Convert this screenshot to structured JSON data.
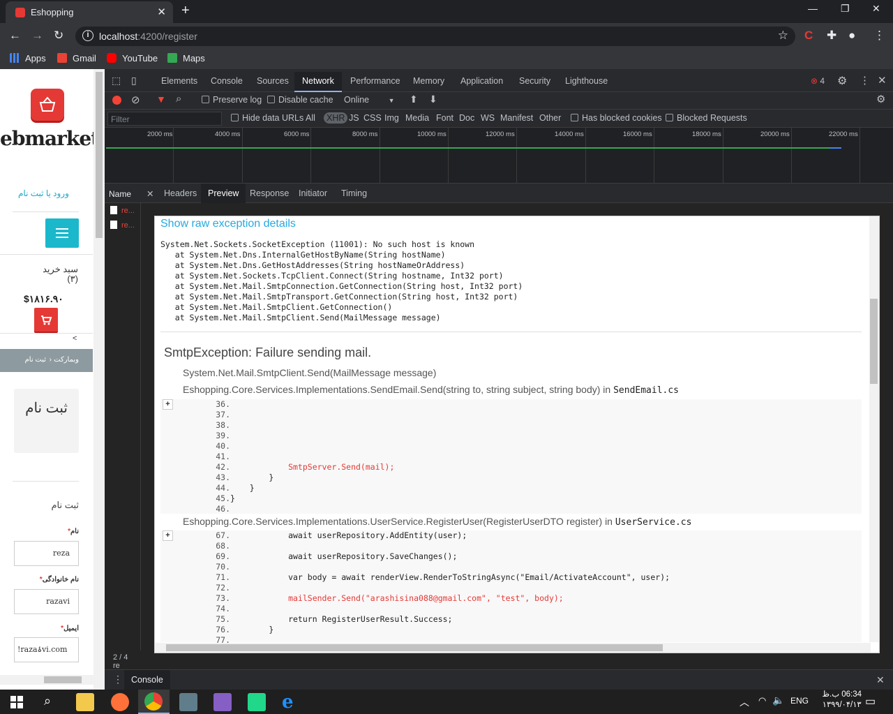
{
  "browser": {
    "tab_title": "Eshopping",
    "url_host": "localhost",
    "url_rest": ":4200/register",
    "bookmarks": [
      "Apps",
      "Gmail",
      "YouTube",
      "Maps"
    ]
  },
  "page": {
    "logo_text": "ebmarket",
    "login_link": "ورود یا ثبت نام",
    "cart_title": "سبد خرید",
    "cart_count": "(۳)",
    "cart_price": "$۱۸۱۶.۹۰",
    "breadcrumb_home": "وبمارکت",
    "breadcrumb_sep": "‹",
    "breadcrumb_current": "ثبت نام",
    "collapse_arrow": "<",
    "register_box_title": "ثبت نام",
    "form_heading": "ثبت نام",
    "fields": [
      {
        "label": "نام",
        "value": "reza"
      },
      {
        "label": "نام خانوادگی",
        "value": "razavi"
      },
      {
        "label": "ایمیل",
        "value": "!razaۀvi.com"
      }
    ],
    "required_mark": "*"
  },
  "devtools": {
    "tabs": [
      "Elements",
      "Console",
      "Sources",
      "Network",
      "Performance",
      "Memory",
      "Application",
      "Security",
      "Lighthouse"
    ],
    "active_tab": "Network",
    "error_count": "4",
    "toolbar": {
      "preserve_log": "Preserve log",
      "disable_cache": "Disable cache",
      "throttle": "Online"
    },
    "filter": {
      "placeholder": "Filter",
      "hide_data_urls": "Hide data URLs",
      "types": [
        "All",
        "XHR",
        "JS",
        "CSS",
        "Img",
        "Media",
        "Font",
        "Doc",
        "WS",
        "Manifest",
        "Other"
      ],
      "selected_type": "XHR",
      "has_blocked_cookies": "Has blocked cookies",
      "blocked_requests": "Blocked Requests"
    },
    "overview_ticks": [
      "2000 ms",
      "4000 ms",
      "6000 ms",
      "8000 ms",
      "10000 ms",
      "12000 ms",
      "14000 ms",
      "16000 ms",
      "18000 ms",
      "20000 ms",
      "22000 ms"
    ],
    "name_header": "Name",
    "requests": [
      "re...",
      "re..."
    ],
    "detail_tabs": [
      "Headers",
      "Preview",
      "Response",
      "Initiator",
      "Timing"
    ],
    "active_detail_tab": "Preview",
    "status_count": "2 / 4 re",
    "drawer_tab": "Console"
  },
  "preview": {
    "raw_link": "Show raw exception details",
    "stack_trace": "System.Net.Sockets.SocketException (11001): No such host is known\n   at System.Net.Dns.InternalGetHostByName(String hostName)\n   at System.Net.Dns.GetHostAddresses(String hostNameOrAddress)\n   at System.Net.Sockets.TcpClient.Connect(String hostname, Int32 port)\n   at System.Net.Mail.SmtpConnection.GetConnection(String host, Int32 port)\n   at System.Net.Mail.SmtpTransport.GetConnection(String host, Int32 port)\n   at System.Net.Mail.SmtpClient.GetConnection()\n   at System.Net.Mail.SmtpClient.Send(MailMessage message)",
    "exception_title": "SmtpException: Failure sending mail.",
    "frame1": "System.Net.Mail.SmtpClient.Send(MailMessage message)",
    "frame2_method": "Eshopping.Core.Services.Implementations.SendEmail.Send(string to, string subject, string body) in ",
    "frame2_file": "SendEmail.cs",
    "block1_lines": [
      "36.",
      "37.",
      "38.",
      "39.",
      "40.",
      "41.",
      "42.",
      "43.",
      "44.",
      "45.",
      "46."
    ],
    "block1_code": [
      "",
      "",
      "",
      "",
      "",
      "",
      "            SmtpServer.Send(mail);",
      "        }",
      "    }",
      "}",
      ""
    ],
    "block1_highlight": "42.",
    "frame3_method": "Eshopping.Core.Services.Implementations.UserService.RegisterUser(RegisterUserDTO register) in ",
    "frame3_file": "UserService.cs",
    "block2_lines": [
      "67.",
      "68.",
      "69.",
      "70.",
      "71.",
      "72.",
      "73.",
      "74.",
      "75.",
      "76.",
      "77."
    ],
    "block2_code": [
      "            await userRepository.AddEntity(user);",
      "",
      "            await userRepository.SaveChanges();",
      "",
      "            var body = await renderView.RenderToStringAsync(\"Email/ActivateAccount\", user);",
      "",
      "            mailSender.Send(\"arashisina088@gmail.com\", \"test\", body);",
      "",
      "            return RegisterUserResult.Success;",
      "        }",
      ""
    ],
    "block2_highlight": "73.",
    "expand_label": "+"
  },
  "taskbar": {
    "language": "ENG",
    "time": "06:34 ب.ظ",
    "date": "۱۳۹۹/۰۴/۱۳"
  }
}
